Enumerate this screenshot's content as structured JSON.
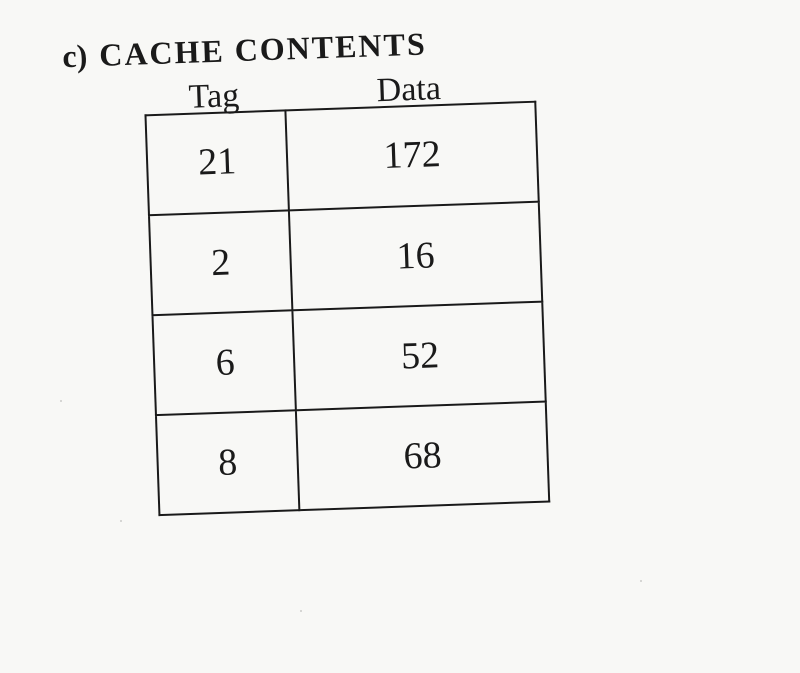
{
  "bullet": "c)",
  "title": "CACHE CONTENTS",
  "columns": {
    "tag": "Tag",
    "data": "Data"
  },
  "rows": [
    {
      "tag": "21",
      "data": "172"
    },
    {
      "tag": "2",
      "data": "16"
    },
    {
      "tag": "6",
      "data": "52"
    },
    {
      "tag": "8",
      "data": "68"
    }
  ],
  "chart_data": {
    "type": "table",
    "title": "CACHE CONTENTS",
    "columns": [
      "Tag",
      "Data"
    ],
    "rows": [
      [
        21,
        172
      ],
      [
        2,
        16
      ],
      [
        6,
        52
      ],
      [
        8,
        68
      ]
    ]
  }
}
